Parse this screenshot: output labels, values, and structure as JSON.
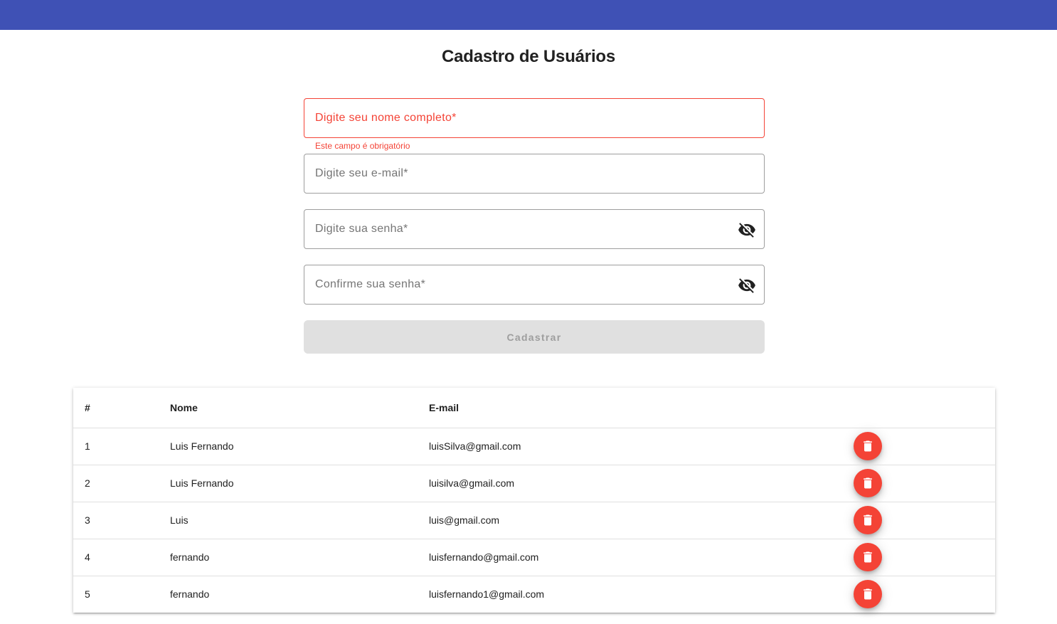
{
  "page": {
    "title": "Cadastro de Usuários"
  },
  "colors": {
    "toolbar": "#3f51b5",
    "warn": "#f44336",
    "disabled_button": "#e0e0e0"
  },
  "form": {
    "name_placeholder": "Digite seu nome completo*",
    "name_error": "Este campo é obrigatório",
    "email_placeholder": "Digite seu e-mail*",
    "password_placeholder": "Digite sua senha*",
    "confirm_placeholder": "Confirme sua senha*",
    "password_toggle_icon": "visibility-off-icon",
    "submit_label": "Cadastrar",
    "submit_disabled": true
  },
  "table": {
    "headers": {
      "id": "#",
      "name": "Nome",
      "email": "E-mail"
    },
    "delete_icon": "trash-icon",
    "rows": [
      {
        "id": "1",
        "name": "Luis Fernando",
        "email": "luisSilva@gmail.com"
      },
      {
        "id": "2",
        "name": "Luis Fernando",
        "email": "luisilva@gmail.com"
      },
      {
        "id": "3",
        "name": "Luis",
        "email": "luis@gmail.com"
      },
      {
        "id": "4",
        "name": "fernando",
        "email": "luisfernando@gmail.com"
      },
      {
        "id": "5",
        "name": "fernando",
        "email": "luisfernando1@gmail.com"
      }
    ]
  }
}
